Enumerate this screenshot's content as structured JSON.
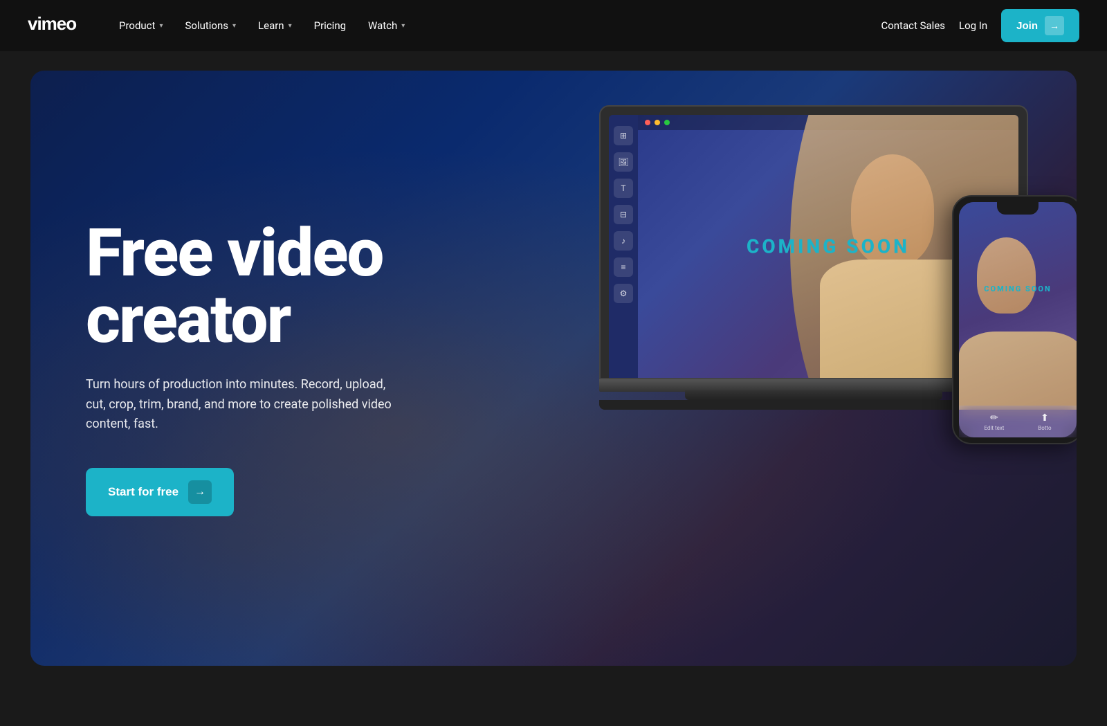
{
  "brand": {
    "name": "vimeo"
  },
  "navbar": {
    "items": [
      {
        "label": "Product",
        "has_dropdown": true
      },
      {
        "label": "Solutions",
        "has_dropdown": true
      },
      {
        "label": "Learn",
        "has_dropdown": true
      },
      {
        "label": "Pricing",
        "has_dropdown": false
      },
      {
        "label": "Watch",
        "has_dropdown": true
      }
    ],
    "right": {
      "contact_sales": "Contact Sales",
      "log_in": "Log In",
      "join": "Join"
    }
  },
  "hero": {
    "title_line1": "Free video",
    "title_line2": "creator",
    "subtitle": "Turn hours of production into minutes. Record, upload, cut, crop, trim, brand, and more to create polished video content, fast.",
    "cta_label": "Start for free",
    "video_text": "COMING SOON",
    "phone_text": "COMING SOON",
    "phone_bottom": {
      "edit_text": "Edit text",
      "botto": "Botto"
    }
  }
}
